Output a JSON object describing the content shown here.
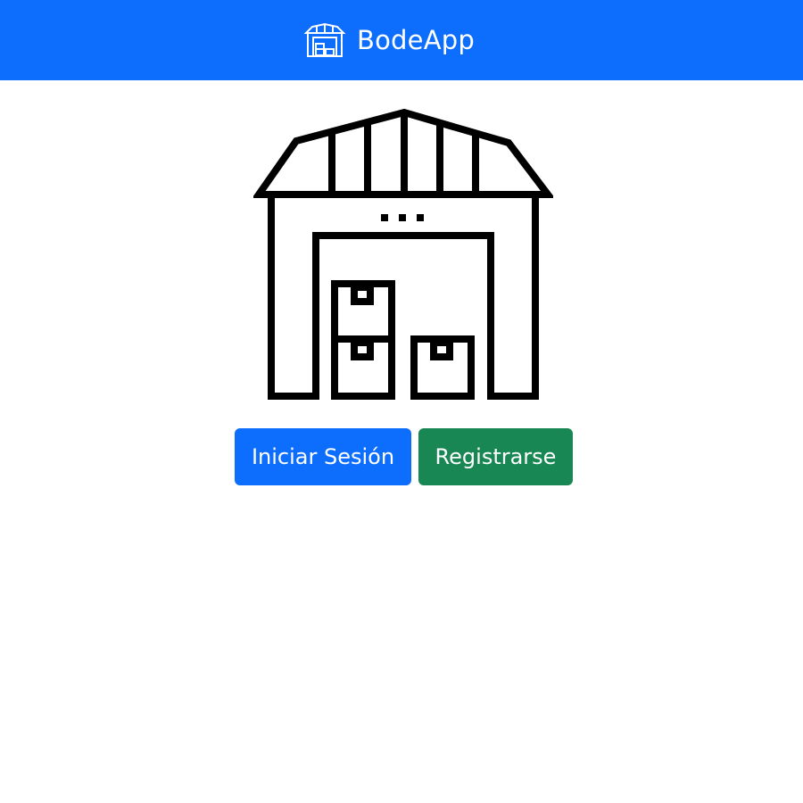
{
  "navbar": {
    "brand_name": "BodeApp",
    "brand_icon": "warehouse-icon",
    "background_color": "#0d6efd"
  },
  "hero": {
    "illustration": "warehouse-icon"
  },
  "actions": {
    "login_label": "Iniciar Sesión",
    "login_color": "#0d6efd",
    "register_label": "Registrarse",
    "register_color": "#198754"
  }
}
